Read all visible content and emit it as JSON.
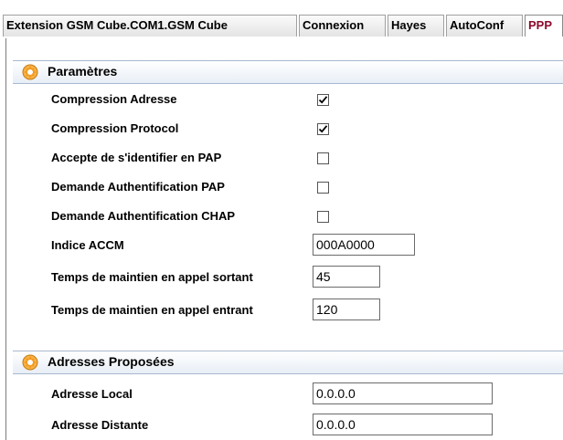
{
  "tabs": [
    {
      "label": "Extension GSM Cube.COM1.GSM Cube",
      "active": false
    },
    {
      "label": "Connexion",
      "active": false
    },
    {
      "label": "Hayes",
      "active": false
    },
    {
      "label": "AutoConf",
      "active": false
    },
    {
      "label": "PPP",
      "active": true
    }
  ],
  "sections": {
    "params": {
      "title": "Paramètres",
      "icon": "gear-icon",
      "compression_adresse": {
        "label": "Compression Adresse",
        "checked": true
      },
      "compression_protocol": {
        "label": "Compression Protocol",
        "checked": true
      },
      "accepte_pap": {
        "label": "Accepte de s'identifier en PAP",
        "checked": false
      },
      "demande_pap": {
        "label": "Demande Authentification PAP",
        "checked": false
      },
      "demande_chap": {
        "label": "Demande Authentification CHAP",
        "checked": false
      },
      "indice_accm": {
        "label": "Indice ACCM",
        "value": "000A0000"
      },
      "temps_sortant": {
        "label": "Temps de maintien en appel sortant",
        "value": "45"
      },
      "temps_entrant": {
        "label": "Temps de maintien en appel entrant",
        "value": "120"
      }
    },
    "addresses": {
      "title": "Adresses Proposées",
      "icon": "gear-icon",
      "adresse_local": {
        "label": "Adresse Local",
        "value": "0.0.0.0"
      },
      "adresse_distante": {
        "label": "Adresse Distante",
        "value": "0.0.0.0"
      }
    }
  },
  "colors": {
    "active_tab_text": "#8b0a2c",
    "section_gradient_end": "#e8eef6",
    "gear_orange": "#f39a1e"
  }
}
